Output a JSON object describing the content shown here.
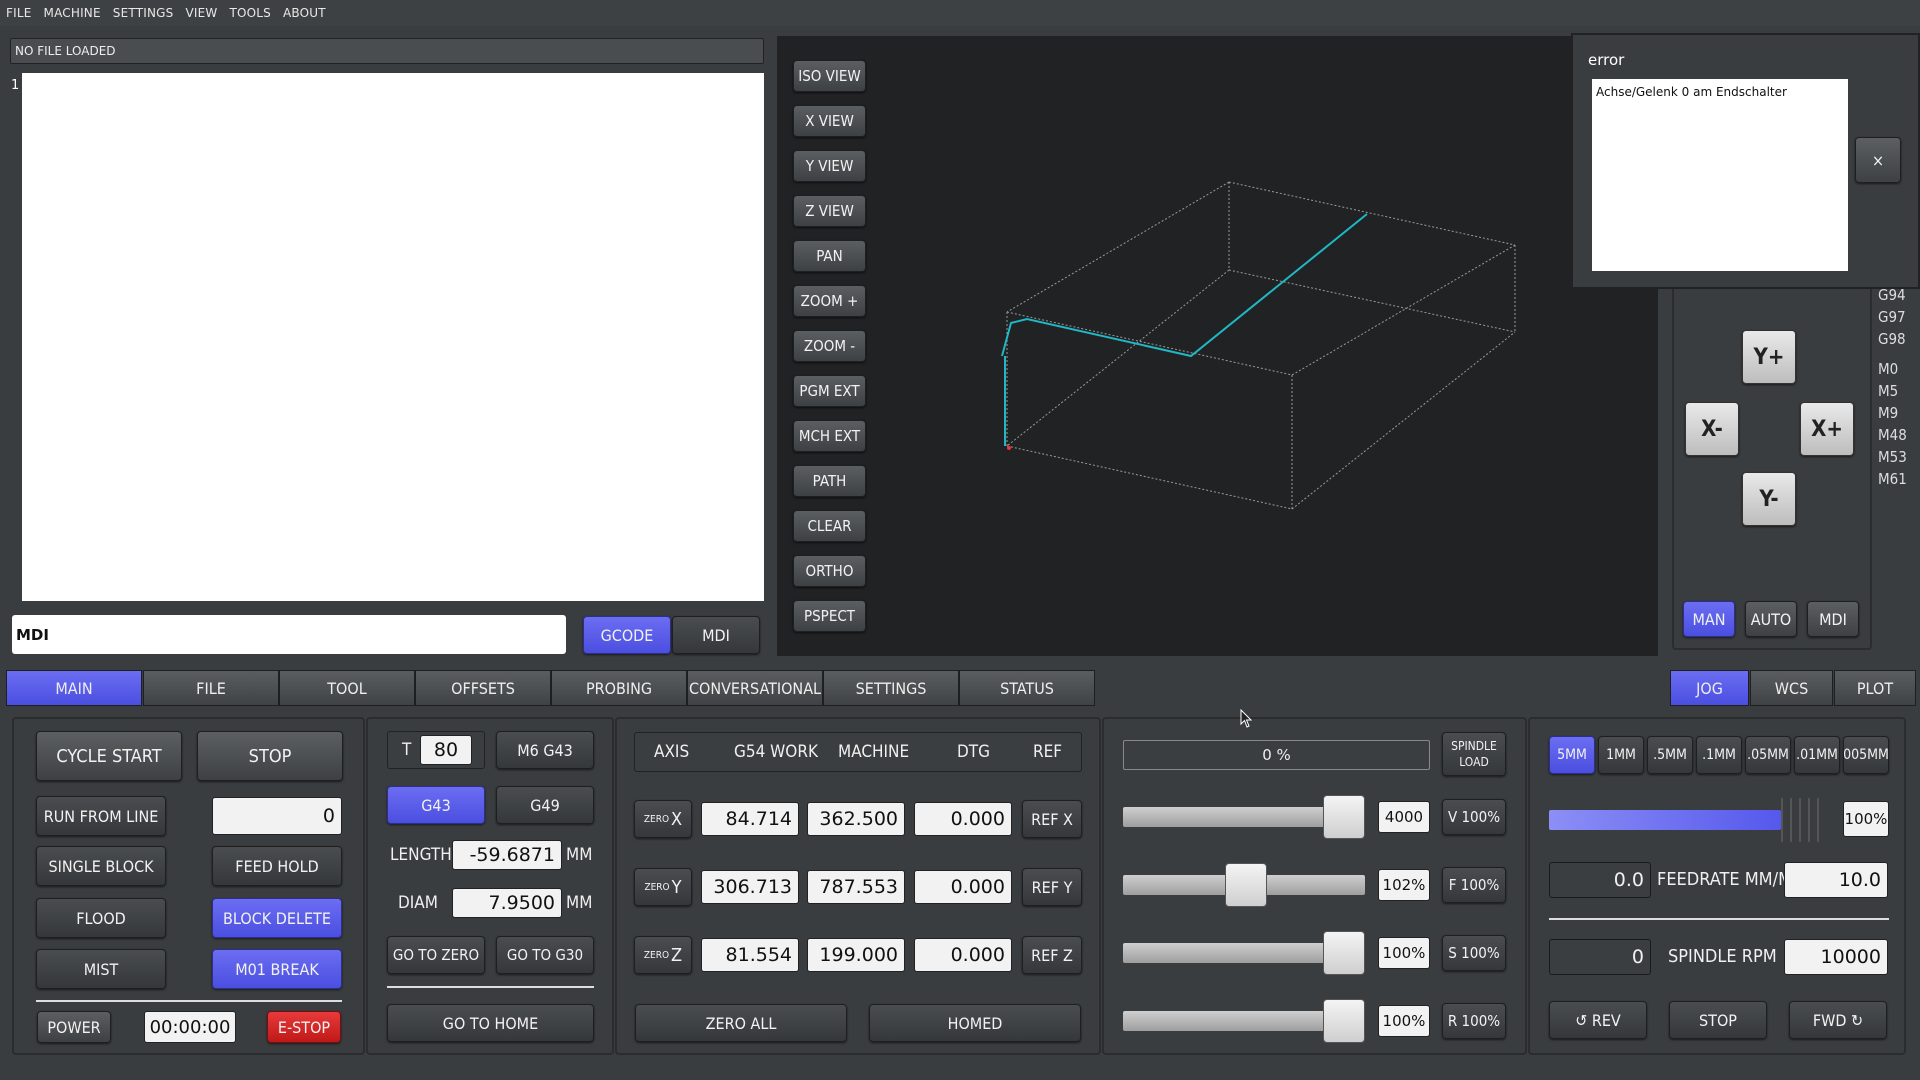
{
  "menu": [
    "FILE",
    "MACHINE",
    "SETTINGS",
    "VIEW",
    "TOOLS",
    "ABOUT"
  ],
  "file": {
    "status": "NO FILE LOADED",
    "line_number": "1"
  },
  "mdi": {
    "value": "MDI",
    "gcode_tab": "GCODE",
    "mdi_tab": "MDI"
  },
  "view_buttons": [
    "ISO VIEW",
    "X VIEW",
    "Y VIEW",
    "Z VIEW",
    "PAN",
    "ZOOM +",
    "ZOOM -",
    "PGM EXT",
    "MCH EXT",
    "PATH",
    "CLEAR",
    "ORTHO",
    "PSPECT"
  ],
  "error_dialog": {
    "title": "error",
    "message": "Achse/Gelenk 0 am Endschalter",
    "close": "×"
  },
  "jog_pad": {
    "y_plus": "Y+",
    "y_minus": "Y-",
    "x_plus": "X+",
    "x_minus": "X-"
  },
  "modes": [
    "MAN",
    "AUTO",
    "MDI"
  ],
  "gcodes": [
    "G94",
    "G97",
    "G98",
    "M0",
    "M5",
    "M9",
    "M48",
    "M53",
    "M61"
  ],
  "tabs": [
    "MAIN",
    "FILE",
    "TOOL",
    "OFFSETS",
    "PROBING",
    "CONVERSATIONAL",
    "SETTINGS",
    "STATUS"
  ],
  "right_tabs": [
    "JOG",
    "WCS",
    "PLOT"
  ],
  "controls": {
    "cycle_start": "CYCLE START",
    "stop": "STOP",
    "run_from_line": "RUN FROM LINE",
    "run_line_value": "0",
    "single_block": "SINGLE BLOCK",
    "feed_hold": "FEED HOLD",
    "flood": "FLOOD",
    "block_delete": "BLOCK DELETE",
    "mist": "MIST",
    "m01_break": "M01 BREAK",
    "power": "POWER",
    "timer": "00:00:00",
    "estop": "E-STOP"
  },
  "tool": {
    "t_label": "T",
    "t_value": "80",
    "m6g43": "M6 G43",
    "g43": "G43",
    "g49": "G49",
    "length_label": "LENGTH",
    "length_value": "-59.6871",
    "length_unit": "MM",
    "diam_label": "DIAM",
    "diam_value": "7.9500",
    "diam_unit": "MM",
    "go_zero": "GO TO ZERO",
    "go_g30": "GO TO G30",
    "go_home": "GO TO HOME"
  },
  "dro": {
    "headers": [
      "AXIS",
      "G54 WORK",
      "MACHINE",
      "DTG",
      "REF"
    ],
    "zero_prefix": "ZERO",
    "rows": [
      {
        "axis": "X",
        "work": "84.714",
        "machine": "362.500",
        "dtg": "0.000",
        "ref": "REF X"
      },
      {
        "axis": "Y",
        "work": "306.713",
        "machine": "787.553",
        "dtg": "0.000",
        "ref": "REF Y"
      },
      {
        "axis": "Z",
        "work": "81.554",
        "machine": "199.000",
        "dtg": "0.000",
        "ref": "REF Z"
      }
    ],
    "zero_all": "ZERO ALL",
    "homed": "HOMED"
  },
  "overrides": {
    "spindle_load_value": "0 %",
    "spindle_load_label_1": "SPINDLE",
    "spindle_load_label_2": "LOAD",
    "rows": [
      {
        "value": "4000",
        "reset": "V 100%",
        "level": 0.91
      },
      {
        "value": "102%",
        "reset": "F 100%",
        "level": 0.51
      },
      {
        "value": "100%",
        "reset": "S 100%",
        "level": 0.91
      },
      {
        "value": "100%",
        "reset": "R 100%",
        "level": 0.91
      }
    ]
  },
  "jog": {
    "increments": [
      "5MM",
      "1MM",
      ".5MM",
      ".1MM",
      ".05MM",
      ".01MM",
      "005MM"
    ],
    "jog_rate": "100%",
    "jog_level": 1.0,
    "feed_value": "0.0",
    "feed_label": "FEEDRATE MM/M",
    "feed_set": "10.0",
    "spindle_value": "0",
    "spindle_label": "SPINDLE RPM",
    "spindle_set": "10000",
    "rev": "↺ REV",
    "stop": "STOP",
    "fwd": "FWD ↻"
  },
  "colors": {
    "accent": "#5558ec",
    "estop": "#d62626",
    "toolpath": "#1fb8c4",
    "bg": "#3a3d3f"
  }
}
